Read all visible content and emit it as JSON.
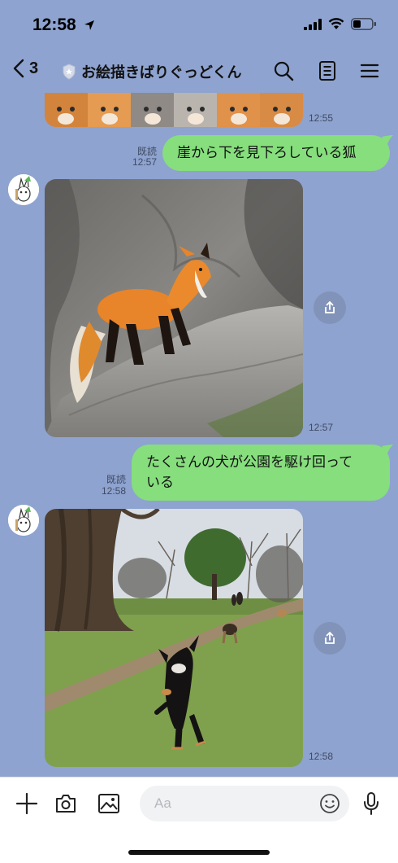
{
  "status_bar": {
    "time": "12:58"
  },
  "header": {
    "back_count": "3",
    "room_name": "お絵描きばりぐっどくん"
  },
  "messages": [
    {
      "type": "image",
      "sender": "bot",
      "alt": "cats image (top cropped)",
      "time": "12:55"
    },
    {
      "type": "text",
      "sender": "me",
      "read": "既読",
      "time": "12:57",
      "text": "崖から下を見下ろしている狐"
    },
    {
      "type": "image",
      "sender": "bot",
      "alt": "fox on a cliff",
      "time": "12:57"
    },
    {
      "type": "text",
      "sender": "me",
      "read": "既読",
      "time": "12:58",
      "lines": [
        "たくさんの犬が公園を駆け回って",
        "いる"
      ]
    },
    {
      "type": "image",
      "sender": "bot",
      "alt": "dogs running in a park",
      "time": "12:58"
    }
  ],
  "input": {
    "placeholder": "Aa"
  },
  "colors": {
    "chat_bg": "#8ea3cf",
    "outgoing_bubble": "#86de7d",
    "bottom_bar": "#ffffff"
  },
  "icons": [
    "back-chevron-icon",
    "shield-badge-icon",
    "search-icon",
    "notes-icon",
    "menu-icon",
    "share-icon",
    "plus-icon",
    "camera-icon",
    "image-icon",
    "emoji-icon",
    "microphone-icon"
  ]
}
